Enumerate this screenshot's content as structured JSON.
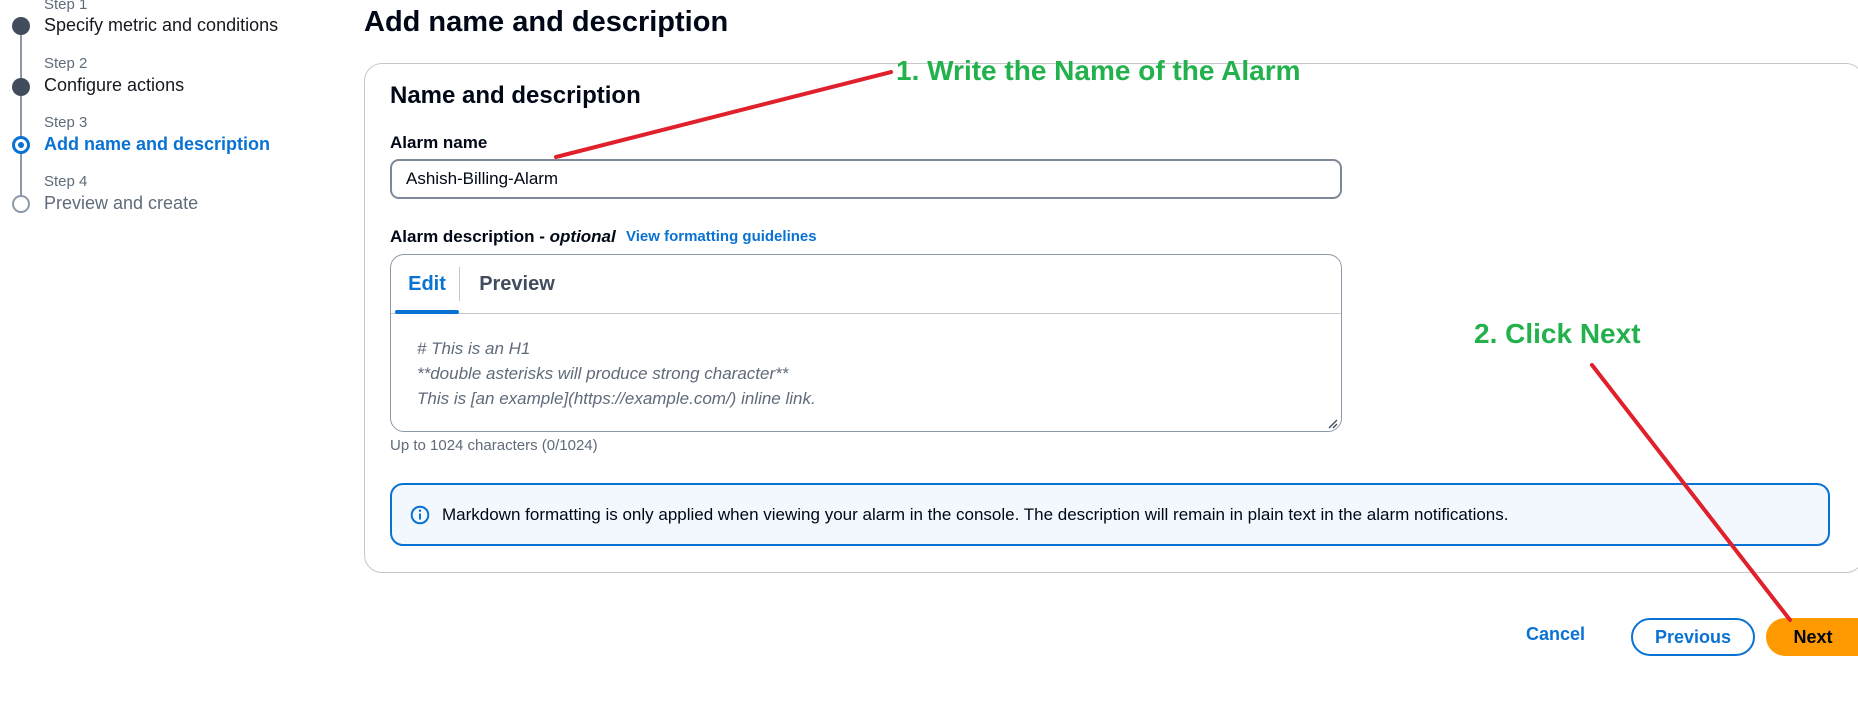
{
  "steps": [
    {
      "number": "Step 1",
      "title": "Specify metric and conditions",
      "state": "completed"
    },
    {
      "number": "Step 2",
      "title": "Configure actions",
      "state": "completed"
    },
    {
      "number": "Step 3",
      "title": "Add name and description",
      "state": "current"
    },
    {
      "number": "Step 4",
      "title": "Preview and create",
      "state": "upcoming"
    }
  ],
  "page_title": "Add name and description",
  "container": {
    "title": "Name and description",
    "alarm_name": {
      "label": "Alarm name",
      "value": "Ashish-Billing-Alarm"
    },
    "description": {
      "label": "Alarm description - ",
      "label_optional": "optional",
      "guidelines_link": "View formatting guidelines",
      "tabs": [
        "Edit",
        "Preview"
      ],
      "active_tab": "Edit",
      "placeholder_lines": [
        "# This is an H1",
        "**double asterisks will produce strong character**",
        "This is [an example](https://example.com/) inline link."
      ],
      "char_hint": "Up to 1024 characters (0/1024)"
    },
    "info_alert": "Markdown formatting is only applied when viewing your alarm in the console. The description will remain in plain text in the alarm notifications."
  },
  "footer": {
    "cancel": "Cancel",
    "previous": "Previous",
    "next": "Next"
  },
  "annotations": {
    "note1": "1. Write the Name of the Alarm",
    "note2": "2. Click Next",
    "color": "#22b14c",
    "arrow_color": "#e0202a"
  },
  "colors": {
    "link": "#0972d3",
    "primary_button": "#ff9900",
    "completed_step": "#414d5c"
  }
}
